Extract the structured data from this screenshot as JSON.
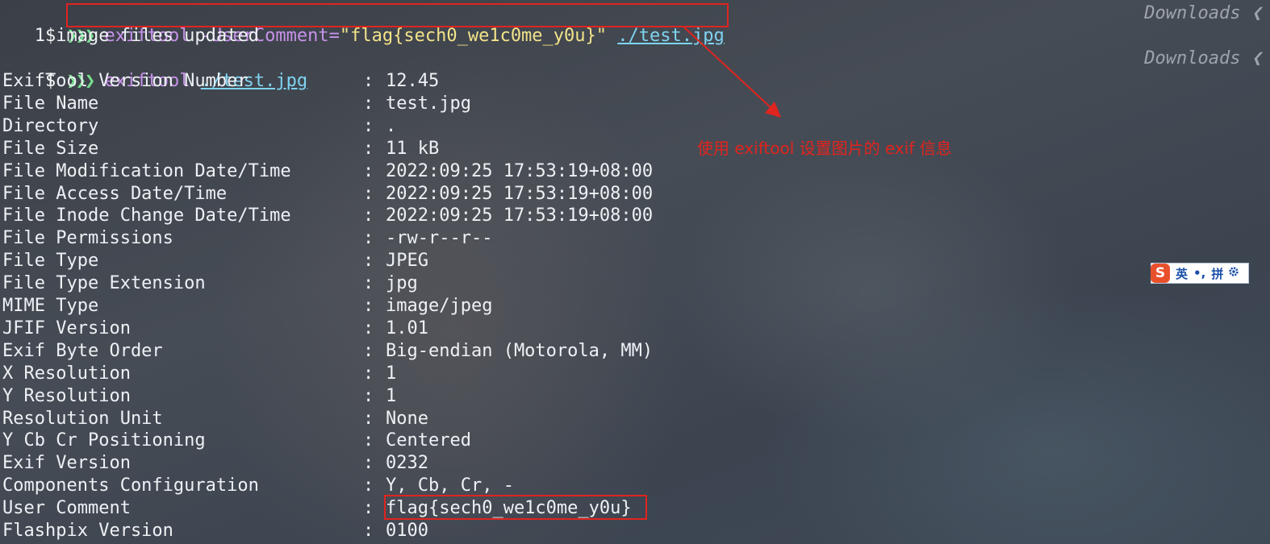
{
  "terminal": {
    "prompt_symbol": "$",
    "prompt_arrows": "❯❯❯",
    "cwd_label": "Downloads ❮",
    "command1": {
      "cmd": "exiftool",
      "option": " -UserComment=",
      "string": "\"flag{sech0_we1c0me_y0u}\"",
      "path": "./test.jpg"
    },
    "output1": "   1 image files updated",
    "command2": {
      "cmd": "exiftool",
      "path": "./test.jpg"
    },
    "separator": ":",
    "exif_rows": [
      {
        "key": "ExifTool Version Number",
        "value": "12.45"
      },
      {
        "key": "File Name",
        "value": "test.jpg"
      },
      {
        "key": "Directory",
        "value": "."
      },
      {
        "key": "File Size",
        "value": "11 kB"
      },
      {
        "key": "File Modification Date/Time",
        "value": "2022:09:25 17:53:19+08:00"
      },
      {
        "key": "File Access Date/Time",
        "value": "2022:09:25 17:53:19+08:00"
      },
      {
        "key": "File Inode Change Date/Time",
        "value": "2022:09:25 17:53:19+08:00"
      },
      {
        "key": "File Permissions",
        "value": "-rw-r--r--"
      },
      {
        "key": "File Type",
        "value": "JPEG"
      },
      {
        "key": "File Type Extension",
        "value": "jpg"
      },
      {
        "key": "MIME Type",
        "value": "image/jpeg"
      },
      {
        "key": "JFIF Version",
        "value": "1.01"
      },
      {
        "key": "Exif Byte Order",
        "value": "Big-endian (Motorola, MM)"
      },
      {
        "key": "X Resolution",
        "value": "1"
      },
      {
        "key": "Y Resolution",
        "value": "1"
      },
      {
        "key": "Resolution Unit",
        "value": "None"
      },
      {
        "key": "Y Cb Cr Positioning",
        "value": "Centered"
      },
      {
        "key": "Exif Version",
        "value": "0232"
      },
      {
        "key": "Components Configuration",
        "value": "Y, Cb, Cr, -"
      },
      {
        "key": "User Comment",
        "value": "flag{sech0_we1c0me_y0u}"
      },
      {
        "key": "Flashpix Version",
        "value": "0100"
      }
    ]
  },
  "annotation": {
    "text": "使用 exiftool 设置图片的 exif 信息",
    "color": "#e0241f"
  },
  "ime_toolbar": {
    "logo": "S",
    "mode": "英",
    "punct": "•,",
    "pinyin": "拼",
    "settings_icon": "gear-icon"
  }
}
